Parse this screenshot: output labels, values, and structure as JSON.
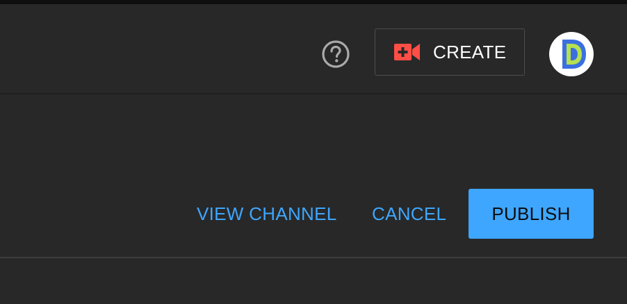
{
  "header": {
    "help_icon": "help-circle-icon",
    "create_button": {
      "label": "CREATE",
      "icon": "video-camera-plus-icon",
      "icon_color": "#ff4e45"
    },
    "avatar": {
      "initial": "D",
      "colors": [
        "#3b6fe0",
        "#b5e04f"
      ]
    }
  },
  "actions": {
    "view_channel": "VIEW CHANNEL",
    "cancel": "CANCEL",
    "publish": "PUBLISH"
  },
  "colors": {
    "background": "#282828",
    "accent": "#3ea6ff",
    "create_icon": "#ff4e45"
  }
}
